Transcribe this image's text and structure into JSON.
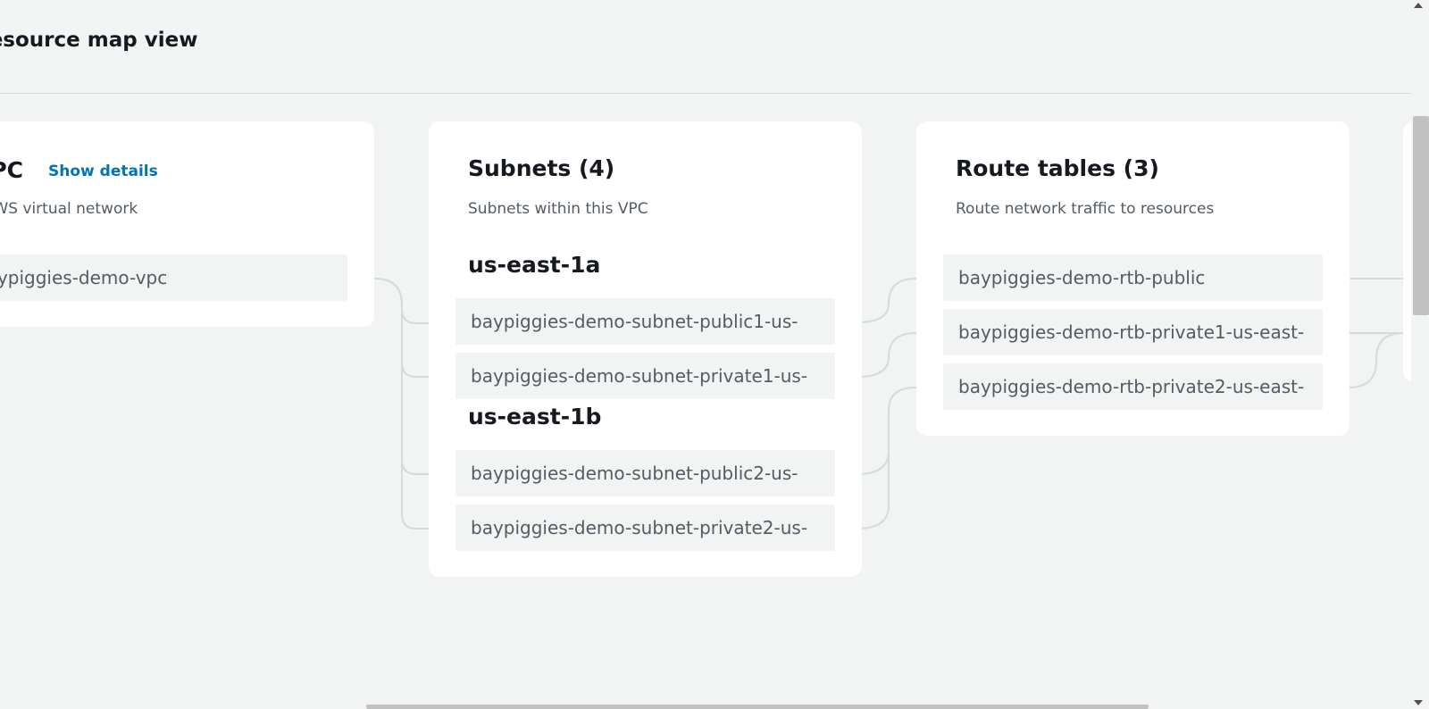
{
  "header": {
    "title": "Resource map view"
  },
  "vpc_panel": {
    "title": "VPC",
    "show_details_label": "Show details",
    "description": "Your AWS virtual network",
    "node": "baypiggies-demo-vpc"
  },
  "subnets_panel": {
    "title": "Subnets (4)",
    "description": "Subnets within this VPC",
    "groups": [
      {
        "zone": "us-east-1a",
        "items": [
          "baypiggies-demo-subnet-public1-us-",
          "baypiggies-demo-subnet-private1-us-"
        ]
      },
      {
        "zone": "us-east-1b",
        "items": [
          "baypiggies-demo-subnet-public2-us-",
          "baypiggies-demo-subnet-private2-us-"
        ]
      }
    ]
  },
  "route_tables_panel": {
    "title": "Route tables (3)",
    "description": "Route network traffic to resources",
    "items": [
      "baypiggies-demo-rtb-public",
      "baypiggies-demo-rtb-private1-us-east-",
      "baypiggies-demo-rtb-private2-us-east-"
    ]
  },
  "colors": {
    "background": "#f2f3f3",
    "panel": "#ffffff",
    "node": "#f2f3f3",
    "connector": "#d5dbdb",
    "link": "#0073bb"
  }
}
